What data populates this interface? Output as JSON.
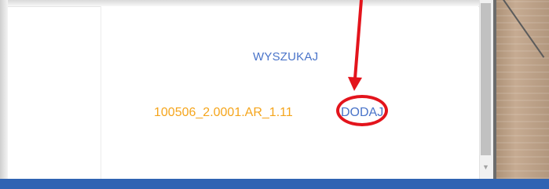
{
  "search": {
    "label": "WYSZUKAJ"
  },
  "record": {
    "code": "100506_2.0001.AR_1.11",
    "add_label": "DODAJ"
  },
  "colors": {
    "link_blue": "#4a74c9",
    "code_orange": "#f5a51c",
    "annotation_red": "#e3141c",
    "bottom_bar_blue": "#2f63b3"
  },
  "icons": {
    "scroll_down": "chevron-down-icon"
  }
}
